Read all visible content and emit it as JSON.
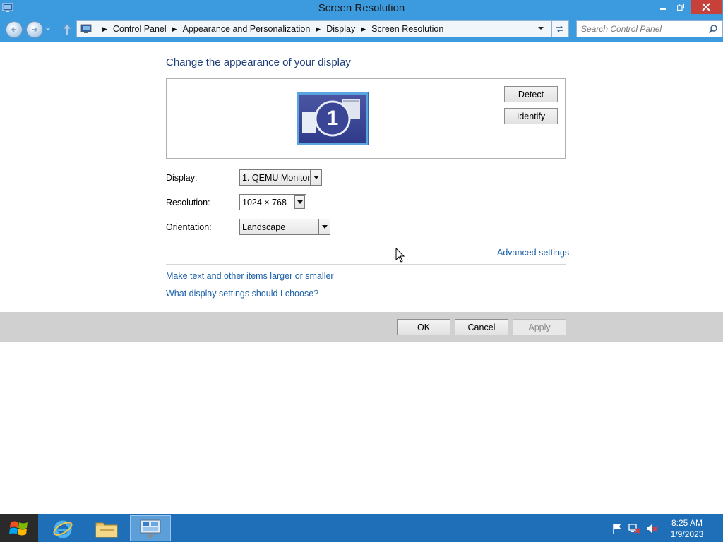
{
  "window": {
    "title": "Screen Resolution",
    "icon": "display-settings-icon"
  },
  "navigation": {
    "breadcrumbs": [
      "Control Panel",
      "Appearance and Personalization",
      "Display",
      "Screen Resolution"
    ],
    "search_placeholder": "Search Control Panel"
  },
  "main": {
    "heading": "Change the appearance of your display",
    "monitor_number": "1",
    "detect_label": "Detect",
    "identify_label": "Identify",
    "display_label": "Display:",
    "display_value": "1. QEMU Monitor",
    "resolution_label": "Resolution:",
    "resolution_value": "1024 × 768",
    "orientation_label": "Orientation:",
    "orientation_value": "Landscape",
    "advanced_link": "Advanced settings",
    "links": [
      "Make text and other items larger or smaller",
      "What display settings should I choose?"
    ]
  },
  "footer": {
    "ok_label": "OK",
    "cancel_label": "Cancel",
    "apply_label": "Apply",
    "apply_enabled": false
  },
  "taskbar": {
    "pinned": [
      "internet-explorer-icon",
      "file-explorer-icon",
      "control-panel-icon"
    ],
    "active": "control-panel-icon",
    "tray_icons": [
      "action-center-flag-icon",
      "network-icon",
      "volume-muted-icon"
    ],
    "time": "8:25 AM",
    "date": "1/9/2023"
  },
  "colors": {
    "title_bar": "#3c9adf",
    "close_button": "#c7403a",
    "heading": "#1e3f7a",
    "link": "#1b5fa8",
    "taskbar": "#1f6fb8",
    "button_bar": "#d0d0d0"
  }
}
